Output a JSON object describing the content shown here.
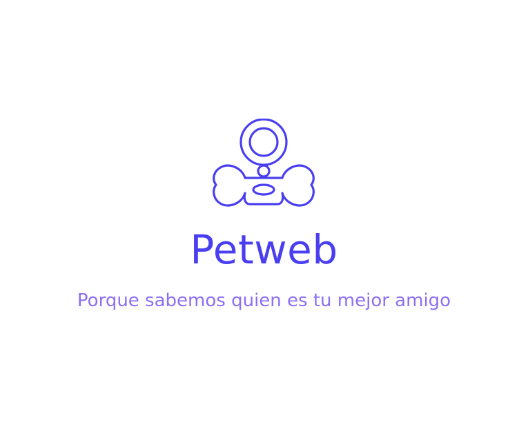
{
  "brand": {
    "name": "Petweb",
    "tagline": "Porque sabemos quien es tu mejor amigo"
  },
  "logo": {
    "icon": "bone-tag-icon",
    "color": "#4a3ff0"
  },
  "colors": {
    "brand": "#4a3ff0",
    "tagline": "#8c6ff2",
    "background": "#ffffff"
  }
}
